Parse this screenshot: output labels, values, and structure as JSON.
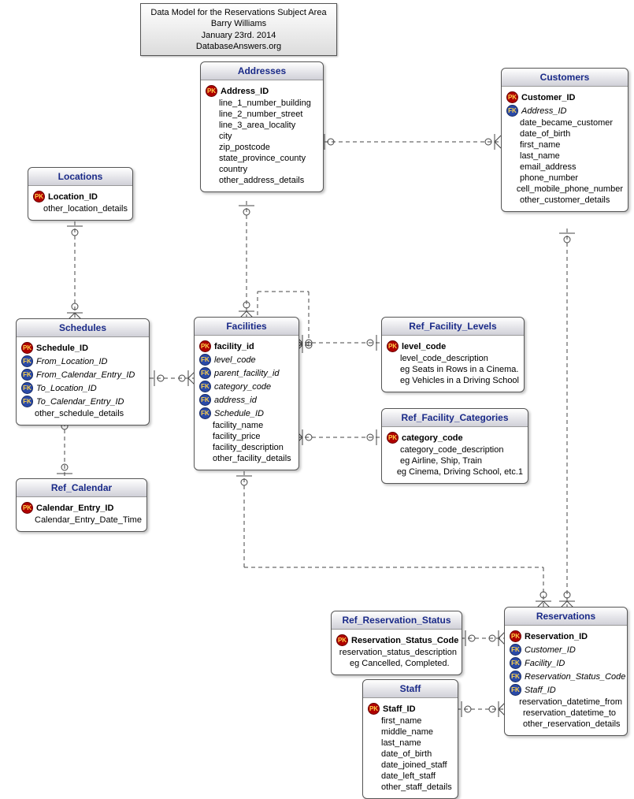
{
  "info_box": {
    "line1": "Data Model for the Reservations Subject Area",
    "line2": "Barry Williams",
    "line3": "January 23rd. 2014",
    "line4": "DatabaseAnswers.org"
  },
  "entities": {
    "addresses": {
      "title": "Addresses",
      "attrs": [
        {
          "key": "pk",
          "label": "Address_ID",
          "bold": true
        },
        {
          "key": null,
          "label": "line_1_number_building"
        },
        {
          "key": null,
          "label": "line_2_number_street"
        },
        {
          "key": null,
          "label": "line_3_area_locality"
        },
        {
          "key": null,
          "label": "city"
        },
        {
          "key": null,
          "label": "zip_postcode"
        },
        {
          "key": null,
          "label": "state_province_county"
        },
        {
          "key": null,
          "label": "country"
        },
        {
          "key": null,
          "label": "other_address_details"
        }
      ]
    },
    "customers": {
      "title": "Customers",
      "attrs": [
        {
          "key": "pk",
          "label": "Customer_ID",
          "bold": true
        },
        {
          "key": "fk",
          "label": "Address_ID",
          "italic": true
        },
        {
          "key": null,
          "label": "date_became_customer"
        },
        {
          "key": null,
          "label": "date_of_birth"
        },
        {
          "key": null,
          "label": "first_name"
        },
        {
          "key": null,
          "label": "last_name"
        },
        {
          "key": null,
          "label": "email_address"
        },
        {
          "key": null,
          "label": "phone_number"
        },
        {
          "key": null,
          "label": "cell_mobile_phone_number"
        },
        {
          "key": null,
          "label": "other_customer_details"
        }
      ]
    },
    "locations": {
      "title": "Locations",
      "attrs": [
        {
          "key": "pk",
          "label": "Location_ID",
          "bold": true
        },
        {
          "key": null,
          "label": "other_location_details"
        }
      ]
    },
    "schedules": {
      "title": "Schedules",
      "attrs": [
        {
          "key": "pk",
          "label": "Schedule_ID",
          "bold": true
        },
        {
          "key": "fk",
          "label": "From_Location_ID",
          "italic": true
        },
        {
          "key": "fk",
          "label": "From_Calendar_Entry_ID",
          "italic": true
        },
        {
          "key": "fk",
          "label": "To_Location_ID",
          "italic": true
        },
        {
          "key": "fk",
          "label": "To_Calendar_Entry_ID",
          "italic": true
        },
        {
          "key": null,
          "label": "other_schedule_details"
        }
      ]
    },
    "ref_calendar": {
      "title": "Ref_Calendar",
      "attrs": [
        {
          "key": "pk",
          "label": "Calendar_Entry_ID",
          "bold": true
        },
        {
          "key": null,
          "label": "Calendar_Entry_Date_Time"
        }
      ]
    },
    "facilities": {
      "title": "Facilities",
      "attrs": [
        {
          "key": "pk",
          "label": "facility_id",
          "bold": true
        },
        {
          "key": "fk",
          "label": "level_code",
          "italic": true
        },
        {
          "key": "fk",
          "label": "parent_facility_id",
          "italic": true
        },
        {
          "key": "fk",
          "label": "category_code",
          "italic": true
        },
        {
          "key": "fk",
          "label": "address_id",
          "italic": true
        },
        {
          "key": "fk",
          "label": "Schedule_ID",
          "italic": true
        },
        {
          "key": null,
          "label": "facility_name"
        },
        {
          "key": null,
          "label": "facility_price"
        },
        {
          "key": null,
          "label": "facility_description"
        },
        {
          "key": null,
          "label": "other_facility_details"
        }
      ]
    },
    "ref_facility_levels": {
      "title": "Ref_Facility_Levels",
      "attrs": [
        {
          "key": "pk",
          "label": "level_code",
          "bold": true
        },
        {
          "key": null,
          "label": "level_code_description"
        },
        {
          "key": null,
          "label": "eg Seats in Rows in a Cinema."
        },
        {
          "key": null,
          "label": "eg Vehicles in a Driving School"
        }
      ]
    },
    "ref_facility_categories": {
      "title": "Ref_Facility_Categories",
      "attrs": [
        {
          "key": "pk",
          "label": "category_code",
          "bold": true
        },
        {
          "key": null,
          "label": "category_code_description"
        },
        {
          "key": null,
          "label": "eg Airline, Ship, Train"
        },
        {
          "key": null,
          "label": "eg Cinema, Driving School, etc.1"
        }
      ]
    },
    "ref_reservation_status": {
      "title": "Ref_Reservation_Status",
      "attrs": [
        {
          "key": "pk",
          "label": "Reservation_Status_Code",
          "bold": true
        },
        {
          "key": null,
          "label": "reservation_status_description"
        },
        {
          "key": null,
          "label": "eg Cancelled, Completed."
        }
      ]
    },
    "staff": {
      "title": "Staff",
      "attrs": [
        {
          "key": "pk",
          "label": "Staff_ID",
          "bold": true
        },
        {
          "key": null,
          "label": "first_name"
        },
        {
          "key": null,
          "label": "middle_name"
        },
        {
          "key": null,
          "label": "last_name"
        },
        {
          "key": null,
          "label": "date_of_birth"
        },
        {
          "key": null,
          "label": "date_joined_staff"
        },
        {
          "key": null,
          "label": "date_left_staff"
        },
        {
          "key": null,
          "label": "other_staff_details"
        }
      ]
    },
    "reservations": {
      "title": "Reservations",
      "attrs": [
        {
          "key": "pk",
          "label": "Reservation_ID",
          "bold": true
        },
        {
          "key": "fk",
          "label": "Customer_ID",
          "italic": true
        },
        {
          "key": "fk",
          "label": "Facility_ID",
          "italic": true
        },
        {
          "key": "fk",
          "label": "Reservation_Status_Code",
          "italic": true
        },
        {
          "key": "fk",
          "label": "Staff_ID",
          "italic": true
        },
        {
          "key": null,
          "label": "reservation_datetime_from"
        },
        {
          "key": null,
          "label": "reservation_datetime_to"
        },
        {
          "key": null,
          "label": "other_reservation_details"
        }
      ]
    }
  }
}
